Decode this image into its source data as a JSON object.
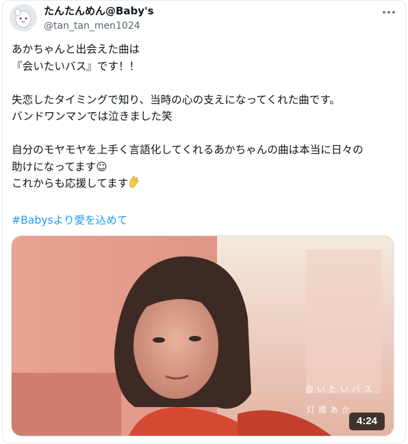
{
  "author": {
    "display_name": "たんたんめん@Baby's",
    "handle": "@tan_tan_men1024",
    "avatar_icon": "cartoon-avatar-icon"
  },
  "more_icon": "more-options-icon",
  "tweet": {
    "paragraph_1": "あかちゃんと出会えた曲は\n『会いたいバス』です！！",
    "paragraph_2": "失恋したタイミングで知り、当時の心の支えになってくれた曲です。\nバンドワンマンでは泣きました笑",
    "paragraph_3_line_1": "自分のモヤモヤを上手く言語化してくれるあかちゃんの曲は本当に日々の",
    "paragraph_3_line_2": "助けになってます☺",
    "paragraph_3_line_3": "これからも応援してます",
    "hashtag": "#Babysより愛を込めて"
  },
  "media": {
    "overlay_title": "会いたいバス",
    "overlay_artist": "灯橋あか",
    "duration": "4:24"
  },
  "colors": {
    "link": "#1d9bf0",
    "text": "#0f1419",
    "secondary": "#536471"
  }
}
